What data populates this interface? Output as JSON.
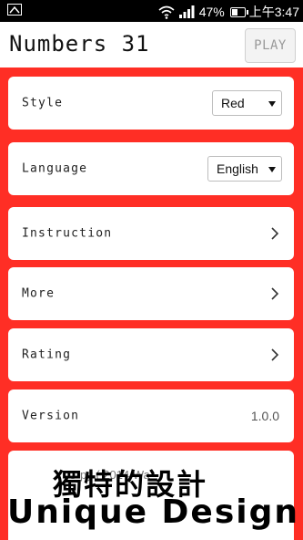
{
  "status_bar": {
    "battery_percent": "47%",
    "time": "上午3:47",
    "battery_level": 0.47
  },
  "header": {
    "title": "Numbers 31",
    "play_label": "PLAY"
  },
  "settings": {
    "style_label": "Style",
    "style_value": "Red",
    "language_label": "Language",
    "language_value": "English",
    "instruction_label": "Instruction",
    "more_label": "More",
    "rating_label": "Rating",
    "version_label": "Version",
    "version_value": "1.0.0"
  },
  "footer": {
    "copyright_partial": "C  py    ( 2014   Wa"
  },
  "overlay": {
    "chinese_caption": "獨特的設計",
    "english_caption": "Unique Design"
  },
  "colors": {
    "background_red": "#ff2e25",
    "card_white": "#ffffff"
  }
}
